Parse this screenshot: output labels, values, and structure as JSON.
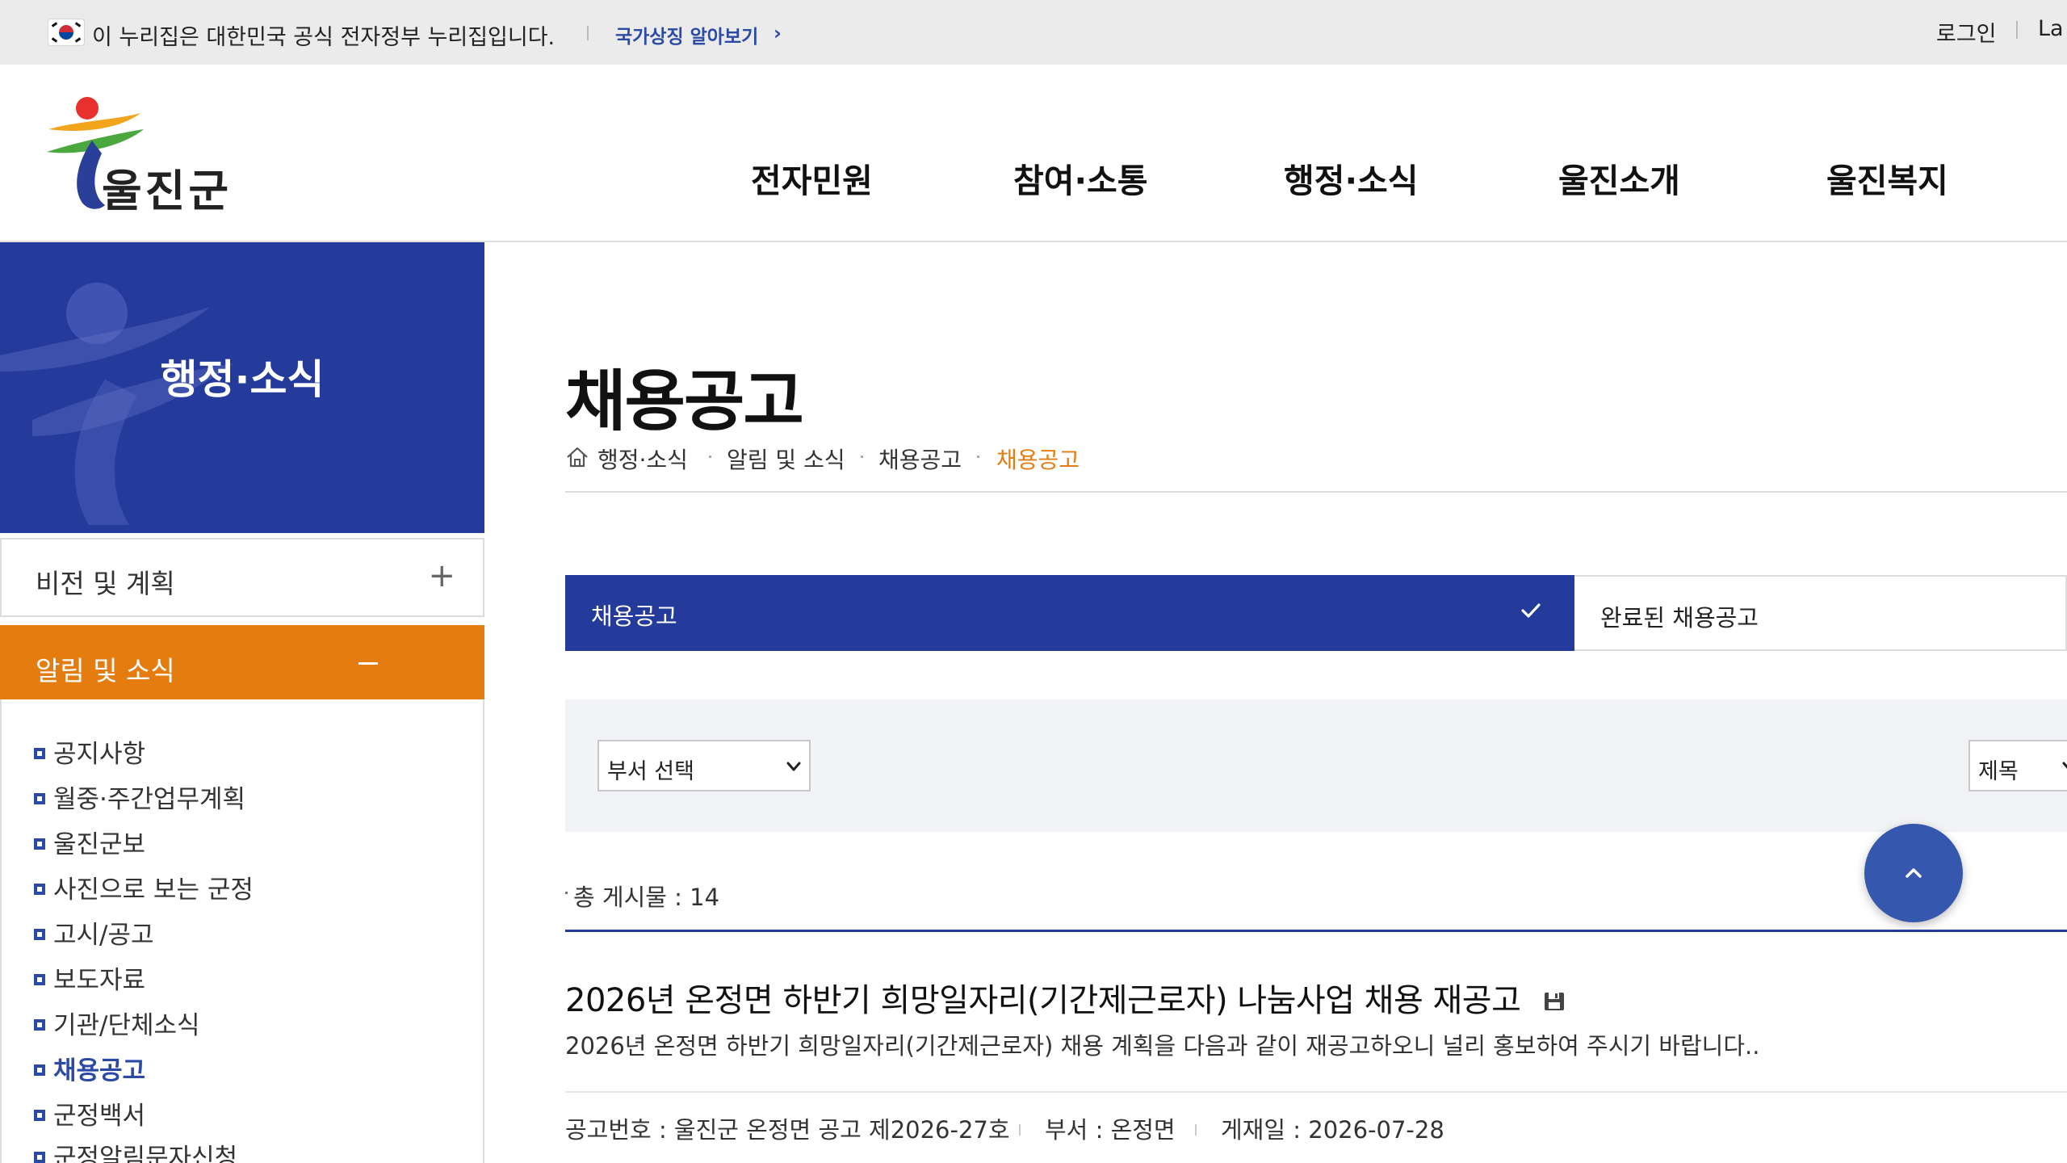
{
  "gov_banner": {
    "notice": "이 누리집은 대한민국 공식 전자정부 누리집입니다.",
    "symbol_link": "국가상징 알아보기",
    "login": "로그인",
    "language": "La"
  },
  "header": {
    "logo_text": "울진군",
    "nav": [
      "전자민원",
      "참여·소통",
      "행정·소식",
      "울진소개",
      "울진복지"
    ]
  },
  "sidebar": {
    "section_title": "행정·소식",
    "groups": [
      {
        "label": "비전 및 계획",
        "expanded": false
      },
      {
        "label": "알림 및 소식",
        "expanded": true
      }
    ],
    "sub_items": [
      "공지사항",
      "월중·주간업무계획",
      "울진군보",
      "사진으로 보는 군정",
      "고시/공고",
      "보도자료",
      "기관/단체소식",
      "채용공고",
      "군정백서",
      "군정알림문자신청"
    ],
    "current_sub_item": "채용공고"
  },
  "content": {
    "page_title": "채용공고",
    "breadcrumb": [
      "행정·소식",
      "알림 및 소식",
      "채용공고",
      "채용공고"
    ],
    "tabs": [
      {
        "label": "채용공고",
        "active": true
      },
      {
        "label": "완료된 채용공고",
        "active": false
      }
    ],
    "search": {
      "department_select": "부서 선택",
      "field_select": "제목"
    },
    "total_label": "총 게시물 : 14",
    "posts": [
      {
        "title": "2026년 온정면 하반기 희망일자리(기간제근로자) 나눔사업 채용 재공고",
        "summary": "2026년 온정면 하반기 희망일자리(기간제근로자) 채용 계획을 다음과 같이 재공고하오니 널리 홍보하여 주시기 바랍니다..",
        "notice_no": "공고번호 : 울진군 온정면 공고 제2026-27호",
        "department": "부서 : 온정면",
        "posted_date": "게재일 : 2026-07-28",
        "has_attachment": true
      }
    ]
  },
  "colors": {
    "primary_blue": "#253b9c",
    "accent_orange": "#e47c10",
    "link_blue": "#2b4aa6",
    "top_button": "#3557ad"
  },
  "icons": [
    "flag-icon",
    "chevron-right-icon",
    "home-icon",
    "plus-icon",
    "minus-icon",
    "check-icon",
    "chevron-down-icon",
    "file-icon",
    "arrow-up-icon"
  ]
}
